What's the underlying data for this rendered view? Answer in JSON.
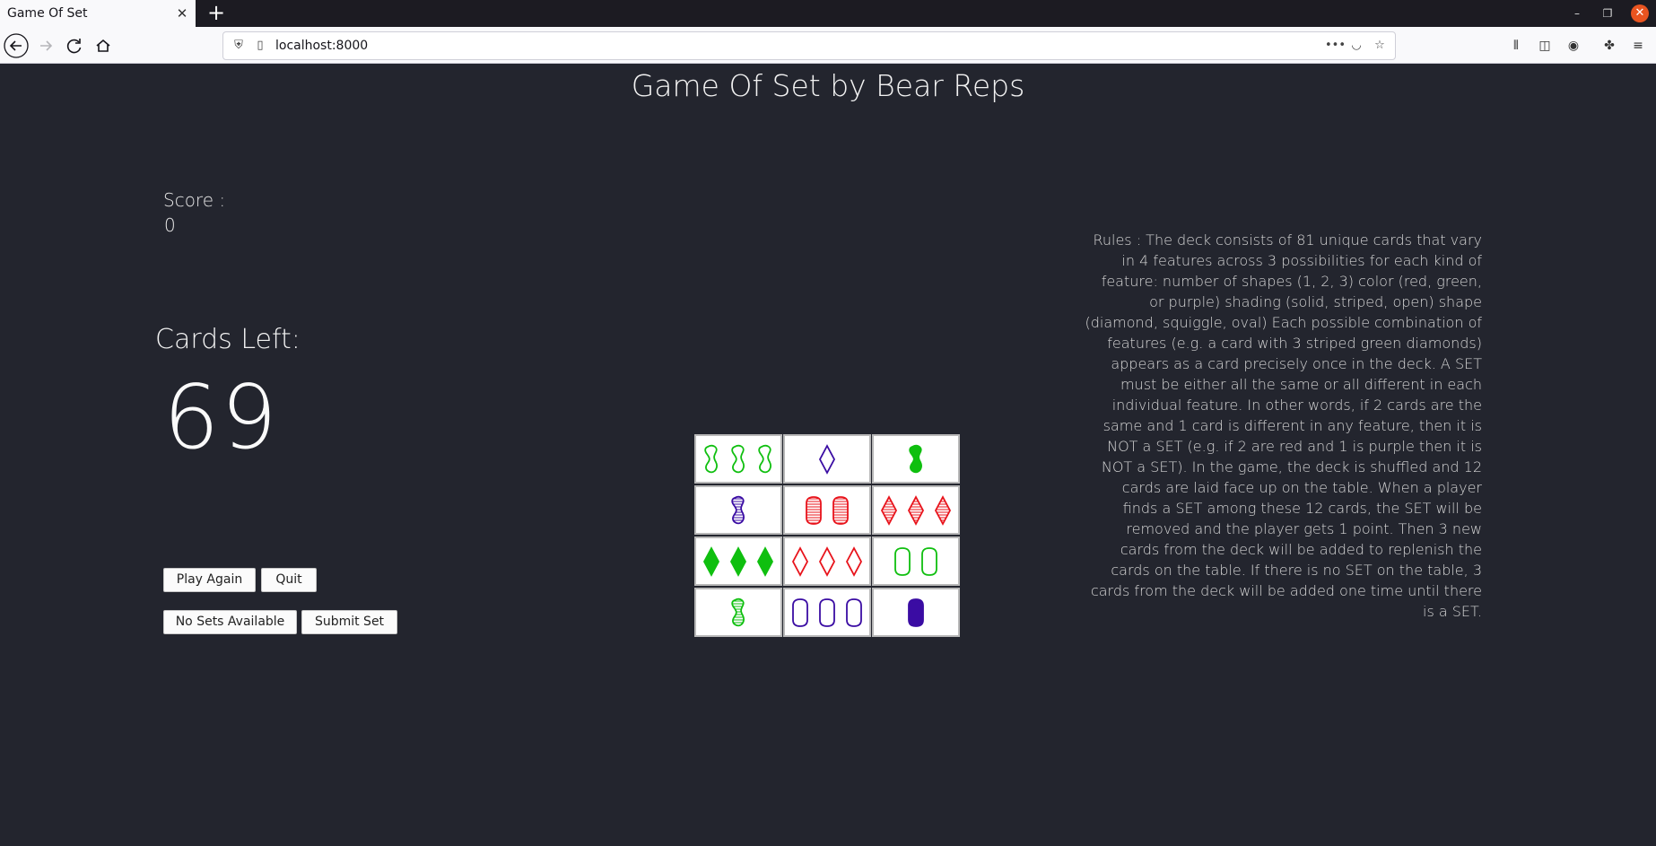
{
  "browser": {
    "tab_title": "Game Of Set",
    "tab_close": "✕",
    "new_tab": "+",
    "url": "localhost:8000",
    "icons": [
      "back-icon",
      "forward-icon",
      "reload-icon",
      "home-icon",
      "shield-icon",
      "page-icon",
      "more-icon",
      "pocket-icon",
      "bookmark-star-icon",
      "library-icon",
      "sidebar-icon",
      "account-icon",
      "extensions-icon",
      "menu-icon"
    ]
  },
  "page": {
    "title": "Game Of Set by Bear Reps",
    "score_label": "Score :",
    "score_value": "0",
    "cards_left_label": "Cards Left:",
    "cards_left_value": "69",
    "buttons": {
      "play_again": "Play Again",
      "quit": "Quit",
      "no_sets": "No Sets Available",
      "submit": "Submit Set"
    },
    "rules_text": "Rules : The deck consists of 81 unique cards that vary in 4 features across 3 possibilities for each kind of feature: number of shapes (1, 2, 3) color (red, green, or purple) shading (solid, striped, open) shape (diamond, squiggle, oval) Each possible combination of features (e.g. a card with 3 striped green diamonds) appears as a card precisely once in the deck. A SET must be either all the same or all different in each individual feature. In other words, if 2 cards are the same and 1 card is different in any feature, then it is NOT a SET (e.g. if 2 are red and 1 is purple then it is NOT a SET). In the game, the deck is shuffled and 12 cards are laid face up on the table. When a player finds a SET among these 12 cards, the SET will be removed and the player gets 1 point. Then 3 new cards from the deck will be added to replenish the cards on the table. If there is no SET on the table, 3 cards from the deck will be added one time until there is a SET."
  },
  "colors": {
    "green": "#0fbf0f",
    "red": "#e8131b",
    "purple": "#3a0ca3",
    "page_bg": "#23252e"
  },
  "cards": [
    {
      "number": 3,
      "color": "green",
      "shading": "open",
      "shape": "squiggle"
    },
    {
      "number": 1,
      "color": "purple",
      "shading": "open",
      "shape": "diamond"
    },
    {
      "number": 1,
      "color": "green",
      "shading": "solid",
      "shape": "squiggle"
    },
    {
      "number": 1,
      "color": "purple",
      "shading": "striped",
      "shape": "squiggle"
    },
    {
      "number": 2,
      "color": "red",
      "shading": "striped",
      "shape": "oval"
    },
    {
      "number": 3,
      "color": "red",
      "shading": "striped",
      "shape": "diamond"
    },
    {
      "number": 3,
      "color": "green",
      "shading": "solid",
      "shape": "diamond"
    },
    {
      "number": 3,
      "color": "red",
      "shading": "open",
      "shape": "diamond"
    },
    {
      "number": 2,
      "color": "green",
      "shading": "open",
      "shape": "oval"
    },
    {
      "number": 1,
      "color": "green",
      "shading": "striped",
      "shape": "squiggle"
    },
    {
      "number": 3,
      "color": "purple",
      "shading": "open",
      "shape": "oval"
    },
    {
      "number": 1,
      "color": "purple",
      "shading": "solid",
      "shape": "oval"
    }
  ]
}
